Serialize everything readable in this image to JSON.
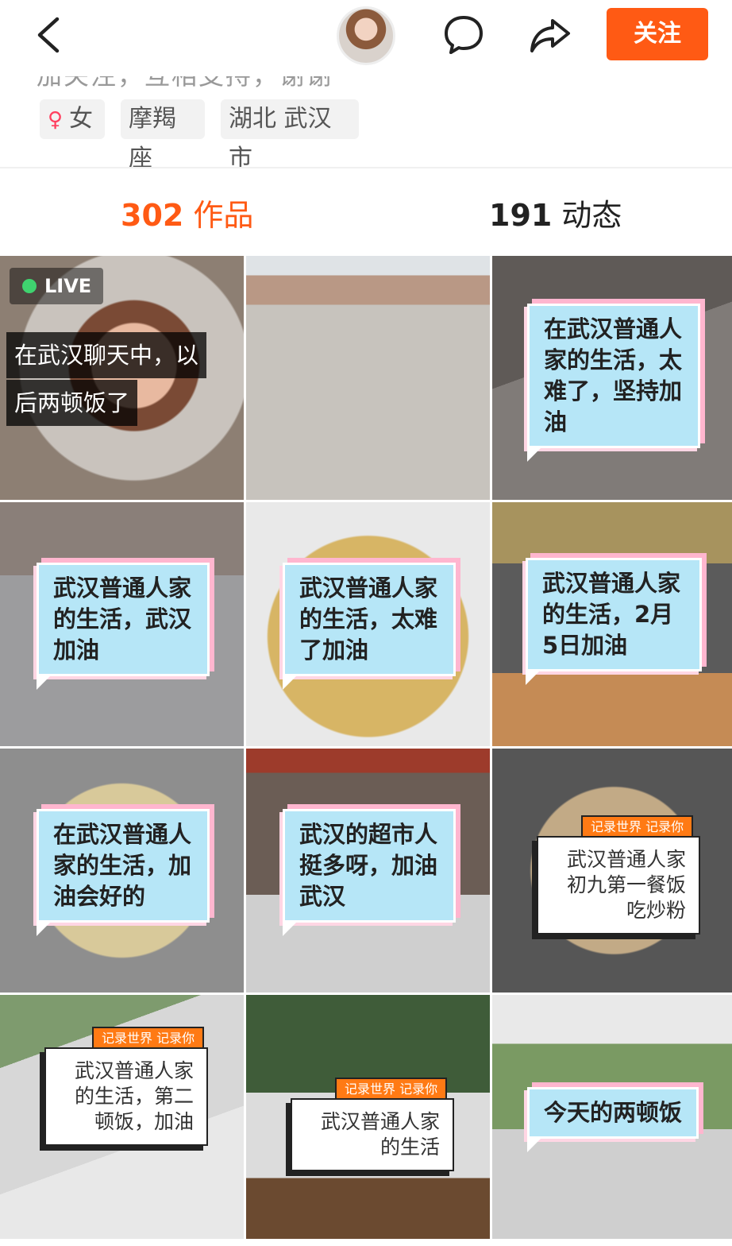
{
  "topbar": {
    "follow_label": "关注"
  },
  "profile": {
    "cut_text": "加关注，互相支持，谢谢",
    "tags": [
      "女",
      "摩羯座",
      "湖北 武汉市"
    ]
  },
  "counts": {
    "works_num": "302",
    "works_label": "作品",
    "dyn_num": "191",
    "dyn_label": "动态"
  },
  "grid": {
    "live_badge": "LIVE",
    "live_line1": "在武汉聊天中，以",
    "live_line2": "后两顿饭了",
    "captions": [
      "在武汉普通人家的生活，太难了，坚持加油",
      "武汉普通人家的生活，武汉加油",
      "武汉普通人家的生活，太难了加油",
      "武汉普通人家的生活，2月5日加油",
      "在武汉普通人家的生活，加油会好的",
      "武汉的超市人挺多呀，加油武汉",
      "武汉普通人家初九第一餐饭吃炒粉",
      "武汉普通人家的生活，第二顿饭，加油",
      "武汉普通人家的生活",
      "今天的两顿饭"
    ],
    "ribbon_text": "记录世界 记录你"
  },
  "colors": {
    "accent": "#ff5a14",
    "caption_blue": "#b6e6f7",
    "ribbon": "#ff7a14",
    "live_dot": "#3fd36f"
  }
}
